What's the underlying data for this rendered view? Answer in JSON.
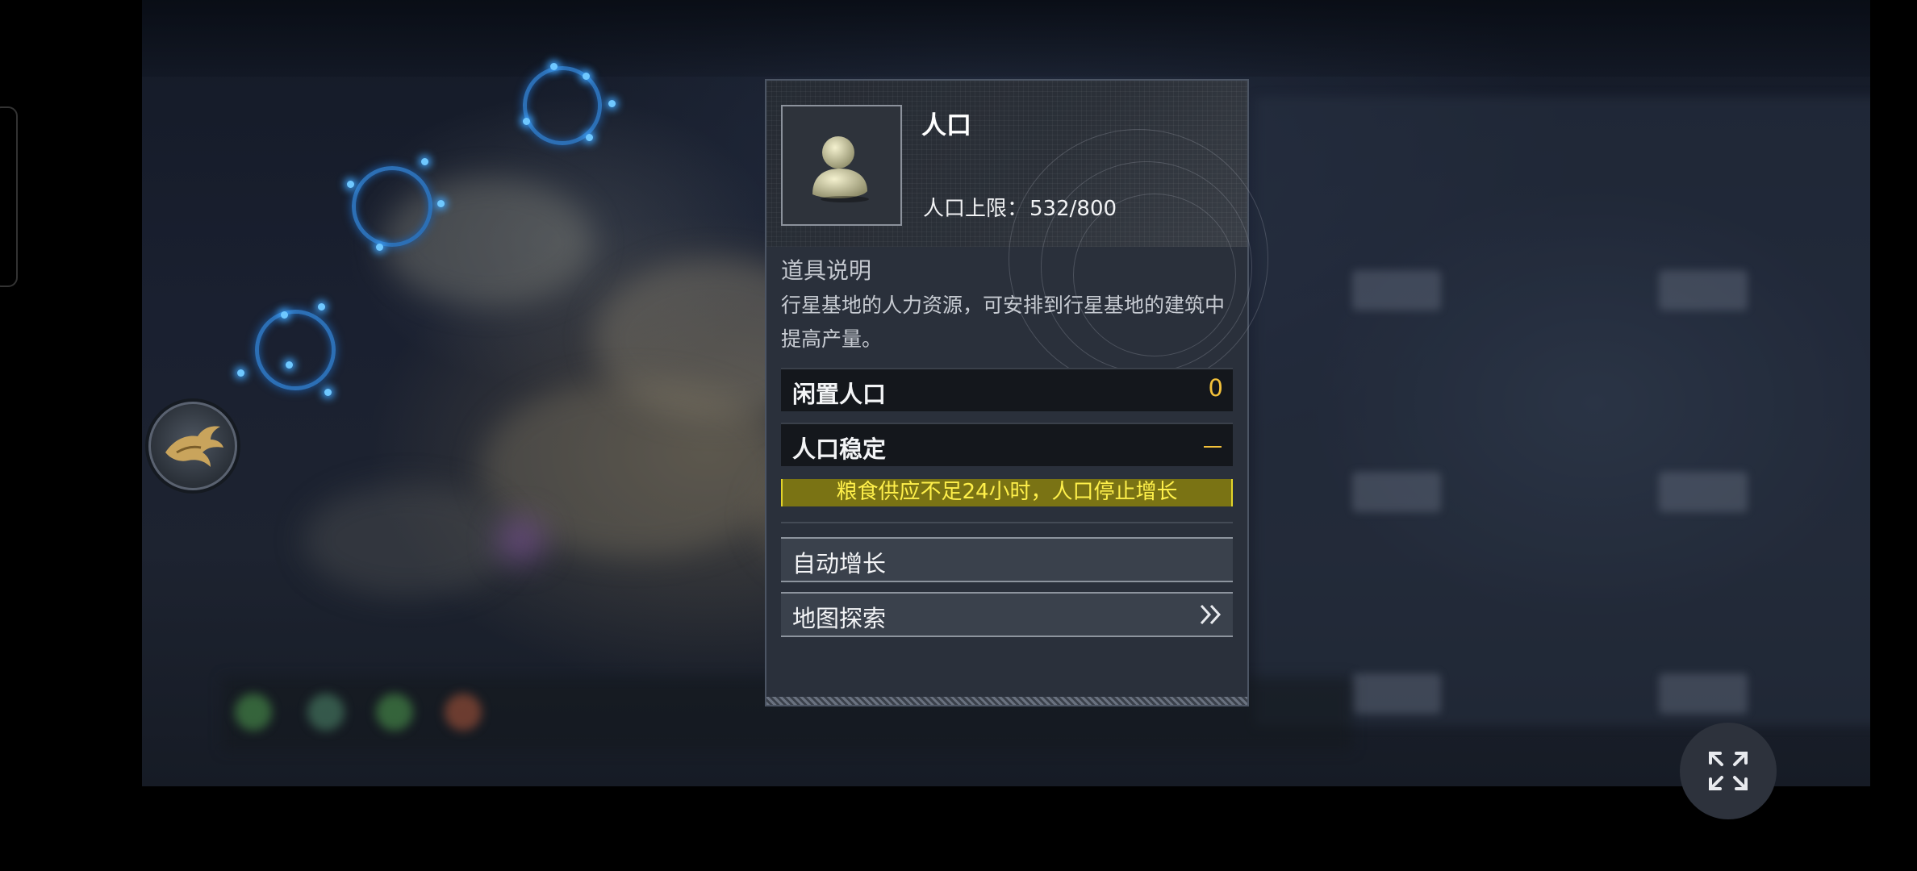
{
  "panel": {
    "title": "人口",
    "cap_label": "人口上限：",
    "cap_value": "532/800",
    "desc_title": "道具说明",
    "desc_text": "行星基地的人力资源，可安排到行星基地的建筑中提高产量。",
    "idle_label": "闲置人口",
    "idle_value": "0",
    "stable_label": "人口稳定",
    "warning": "粮食供应不足24小时，人口停止增长",
    "auto_growth_label": "自动增长",
    "map_explore_label": "地图探索"
  },
  "colors": {
    "accent_yellow": "#f3c13a",
    "warning_bg": "#7a7314",
    "warning_text": "#fff04a",
    "ring_blue": "#2c6fb5"
  },
  "icons": {
    "population": "person-bust-icon",
    "emblem": "phoenix-emblem-icon",
    "map_explore": "double-chevron-right-icon",
    "expand": "expand-arrows-icon"
  }
}
